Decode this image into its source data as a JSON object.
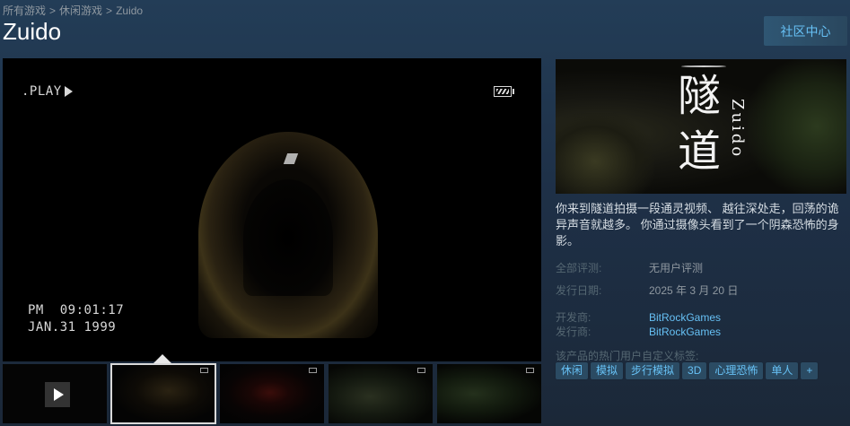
{
  "breadcrumb": {
    "items": [
      "所有游戏",
      "休闲游戏",
      "Zuido"
    ],
    "separator": ">"
  },
  "game": {
    "title": "Zuido",
    "community_button": "社区中心"
  },
  "media": {
    "overlay": {
      "play_label": ".PLAY",
      "time": "PM  09:01:17",
      "date": "JAN.31 1999"
    },
    "thumbnail_count": 5,
    "selected_thumbnail": 1
  },
  "capsule": {
    "title_cjk_1": "隧",
    "title_cjk_2": "道",
    "title_latin": "Zuido"
  },
  "description": "你来到隧道拍摄一段通灵视频、 越往深处走，回荡的诡异声音就越多。 你通过摄像头看到了一个阴森恐怖的身影。",
  "details": {
    "reviews_label": "全部评测:",
    "reviews_value": "无用户评测",
    "release_label": "发行日期:",
    "release_value": "2025 年 3 月 20 日",
    "developer_label": "开发商:",
    "developer_value": "BitRockGames",
    "publisher_label": "发行商:",
    "publisher_value": "BitRockGames"
  },
  "tags": {
    "label": "该产品的热门用户自定义标签:",
    "items": [
      "休闲",
      "模拟",
      "步行模拟",
      "3D",
      "心理恐怖",
      "单人",
      "+"
    ]
  },
  "colors": {
    "link": "#66c0f4",
    "tag_bg": "#2b4b63",
    "page_bg": "#1b2838"
  }
}
